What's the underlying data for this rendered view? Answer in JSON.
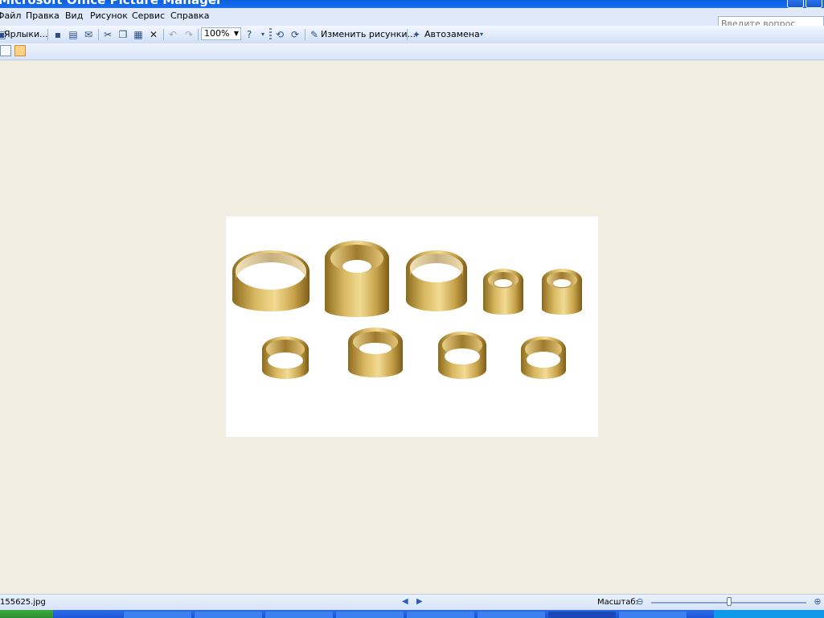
{
  "window": {
    "title": "Microsoft Office Picture Manager"
  },
  "menu": [
    {
      "label": "Файл",
      "id": "file"
    },
    {
      "label": "Правка",
      "id": "edit"
    },
    {
      "label": "Вид",
      "id": "view"
    },
    {
      "label": "Рисунок",
      "id": "picture"
    },
    {
      "label": "Сервис",
      "id": "tools"
    },
    {
      "label": "Справка",
      "id": "help"
    }
  ],
  "search": {
    "placeholder": "Введите вопрос"
  },
  "toolbar": {
    "shortcuts_label": "Ярлыки...",
    "zoom_value": "100%",
    "edit_pictures_label": "Изменить рисунки...",
    "autocorrect_label": "Автозамена"
  },
  "status": {
    "filename": "155625.jpg",
    "zoom_label": "Масштаб:"
  },
  "photo": {
    "description_items": 9
  }
}
